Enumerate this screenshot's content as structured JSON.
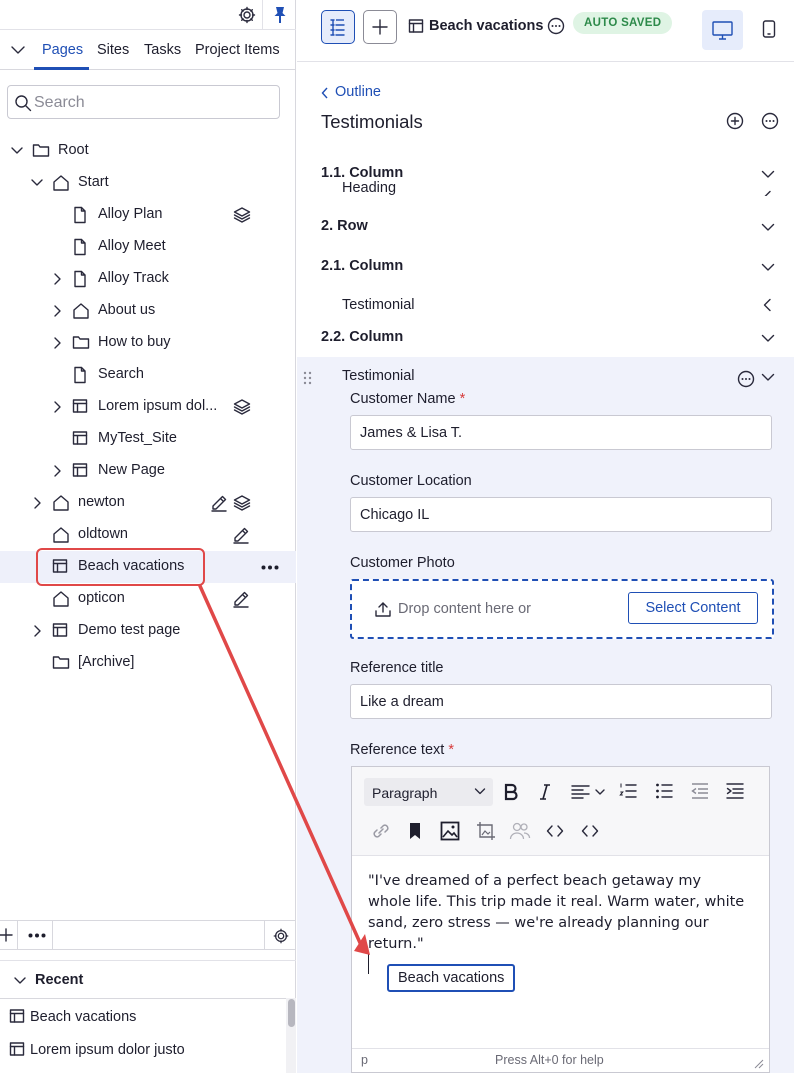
{
  "left": {
    "tabs": [
      "Pages",
      "Sites",
      "Tasks",
      "Project Items"
    ],
    "active_tab": "Pages",
    "search_placeholder": "Search",
    "tree": [
      {
        "label": "Root"
      },
      {
        "label": "Start"
      },
      {
        "label": "Alloy Plan"
      },
      {
        "label": "Alloy Meet"
      },
      {
        "label": "Alloy Track"
      },
      {
        "label": "About us"
      },
      {
        "label": "How to buy"
      },
      {
        "label": "Search"
      },
      {
        "label": "Lorem ipsum dol..."
      },
      {
        "label": "MyTest_Site"
      },
      {
        "label": "New Page"
      },
      {
        "label": "newton"
      },
      {
        "label": "oldtown"
      },
      {
        "label": "Beach vacations"
      },
      {
        "label": "opticon"
      },
      {
        "label": "Demo test page"
      },
      {
        "label": "[Archive]"
      }
    ],
    "recent_title": "Recent",
    "recent": [
      "Beach vacations",
      "Lorem ipsum dolor justo"
    ]
  },
  "right": {
    "page_title": "Beach vacations",
    "status_badge": "AUTO SAVED",
    "outline_link": "Outline",
    "section_title": "Testimonials",
    "outline": [
      {
        "label": "1.1. Column"
      },
      {
        "label": "Heading"
      },
      {
        "label": "2. Row"
      },
      {
        "label": "2.1. Column"
      },
      {
        "label": "Testimonial"
      },
      {
        "label": "2.2. Column"
      },
      {
        "label": "Testimonial"
      }
    ],
    "fields": {
      "customer_name_label": "Customer Name",
      "customer_name_value": "James & Lisa T.",
      "customer_location_label": "Customer Location",
      "customer_location_value": "Chicago IL",
      "customer_photo_label": "Customer Photo",
      "drop_text": "Drop content here or",
      "select_content": "Select Content",
      "reference_title_label": "Reference title",
      "reference_title_value": "Like a dream",
      "reference_text_label": "Reference text",
      "required_mark": "*"
    },
    "editor": {
      "block_format": "Paragraph",
      "body": "\"I've dreamed of a perfect beach getaway my whole life. This trip made it real. Warm water, white sand, zero stress — we're already planning our return.\"",
      "drag_tag": "Beach vacations",
      "status_path": "p",
      "status_help": "Press Alt+0 for help"
    }
  },
  "colors": {
    "accent": "#1f4fb5",
    "annotation": "#e04848",
    "success_bg": "#dff4e4",
    "success_text": "#2d8a4a",
    "panel_bg": "#f0f2fb"
  }
}
